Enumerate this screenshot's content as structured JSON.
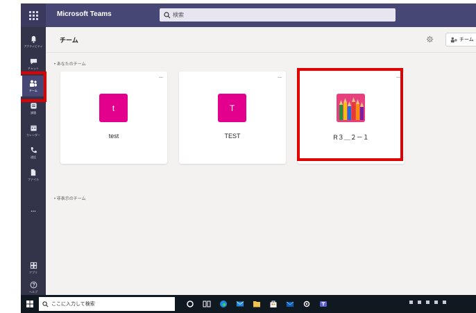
{
  "app": {
    "title": "Microsoft Teams"
  },
  "search": {
    "placeholder": "検索"
  },
  "rail": {
    "items": [
      {
        "label": "アクティビティ",
        "icon": "bell-icon"
      },
      {
        "label": "チャット",
        "icon": "chat-icon"
      },
      {
        "label": "チーム",
        "icon": "teams-icon",
        "active": true
      },
      {
        "label": "課題",
        "icon": "assignments-icon"
      },
      {
        "label": "カレンダー",
        "icon": "calendar-icon"
      },
      {
        "label": "通話",
        "icon": "phone-icon"
      },
      {
        "label": "ファイル",
        "icon": "file-icon"
      }
    ],
    "more": "...",
    "bottom": [
      {
        "label": "アプリ",
        "icon": "apps-icon"
      },
      {
        "label": "ヘルプ",
        "icon": "help-icon"
      }
    ]
  },
  "header": {
    "title": "チーム",
    "join_label": "チーム"
  },
  "sections": {
    "your_teams": "• あなたのチーム",
    "hidden_teams": "• 非表示のチーム"
  },
  "teams": [
    {
      "name": "test",
      "avatar_letter": "t",
      "color": "#e3008c"
    },
    {
      "name": "TEST",
      "avatar_letter": "T",
      "color": "#e3008c"
    },
    {
      "name": "R３＿２－１",
      "avatar": "pencils-image"
    }
  ],
  "card_menu": "...",
  "taskbar": {
    "search_text": "ここに入力して検索"
  },
  "colors": {
    "topbar": "#464775",
    "rail": "#33344a",
    "highlight": "#e00000",
    "avatar": "#e3008c"
  }
}
